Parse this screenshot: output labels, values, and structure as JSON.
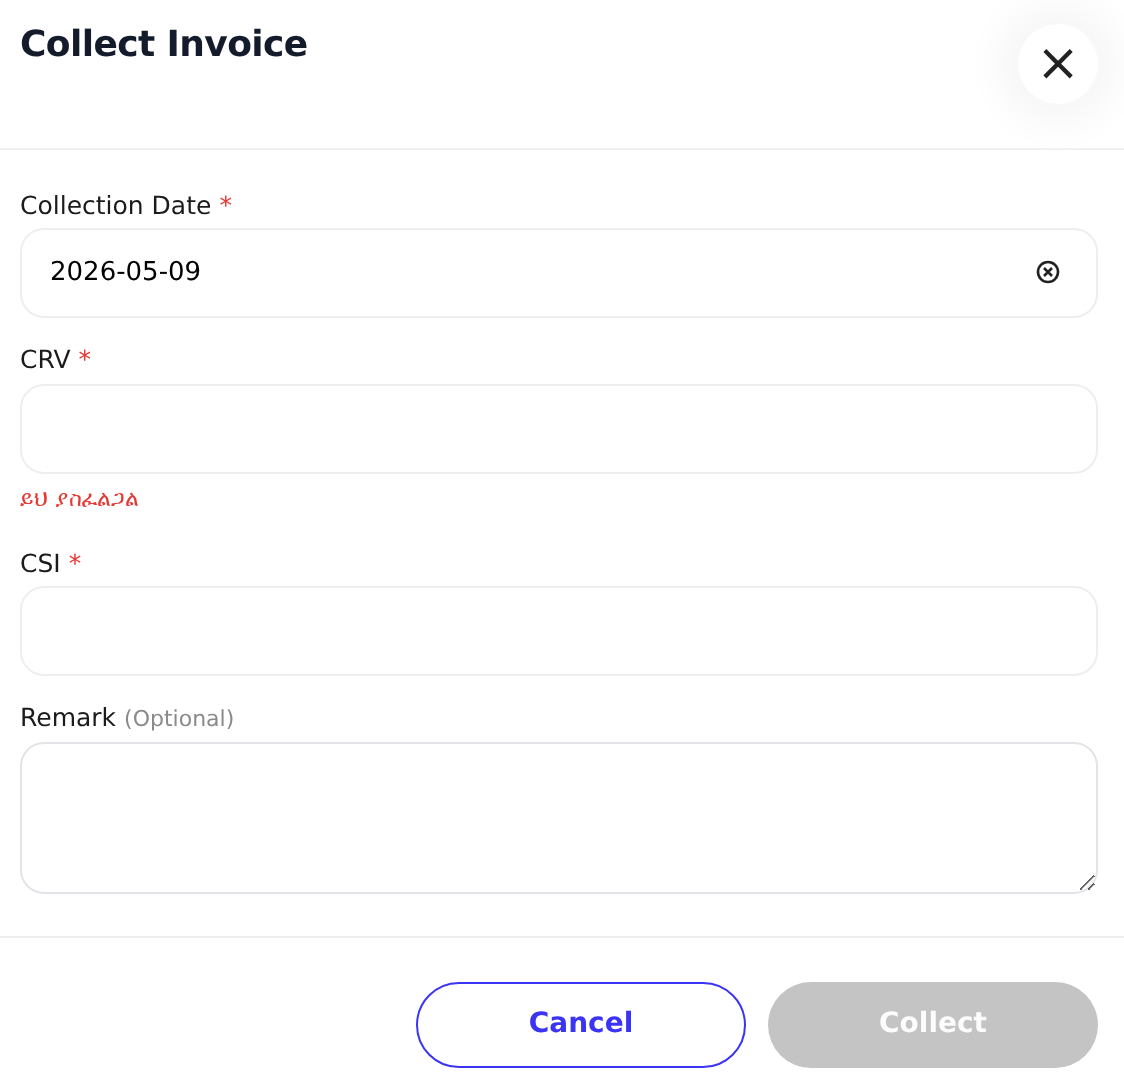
{
  "dialog": {
    "title": "Collect Invoice",
    "close_symbol": "×"
  },
  "fields": [
    {
      "kind": "date",
      "label": "Collection Date",
      "required_mark": "*",
      "value": "2026-05-09"
    },
    {
      "kind": "text",
      "label": "CRV",
      "required_mark": "*",
      "error": "ይህ ያስፈልጋል"
    },
    {
      "kind": "text",
      "label": "CSI",
      "required_mark": "*"
    },
    {
      "kind": "textarea",
      "label": "Remark",
      "note": "(Optional)"
    }
  ],
  "buttons": [
    {
      "kind": "outline",
      "label": "Cancel",
      "disabled": false
    },
    {
      "kind": "primary",
      "label": "Collect",
      "disabled": true
    }
  ]
}
